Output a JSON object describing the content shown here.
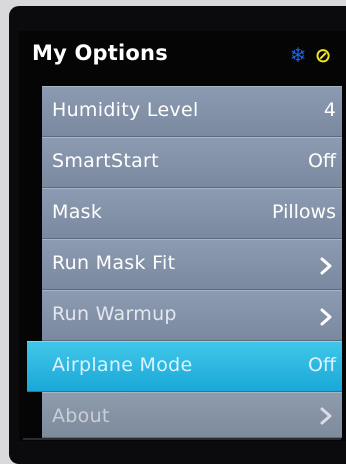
{
  "header": {
    "title": "My Options",
    "status_icons": [
      {
        "name": "snowflake-icon",
        "glyph": "❄",
        "color": "#1e63e0"
      },
      {
        "name": "no-sign-icon",
        "glyph": "⊘",
        "color": "#f2e51e"
      }
    ]
  },
  "menu": {
    "items": [
      {
        "label": "Humidity Level",
        "value": "4"
      },
      {
        "label": "SmartStart",
        "value": "Off"
      },
      {
        "label": "Mask",
        "value": "Pillows"
      },
      {
        "label": "Run Mask Fit",
        "value": "",
        "icon": "chevron-right-icon"
      },
      {
        "label": "Run Warmup",
        "value": "",
        "icon": "chevron-right-icon"
      },
      {
        "label": "Airplane Mode",
        "value": "Off",
        "selected": true
      },
      {
        "label": "About",
        "value": "",
        "icon": "chevron-right-icon"
      }
    ]
  },
  "colors": {
    "item_background": "#8596ac",
    "selected_background": "#2bb8e4",
    "screen_background": "#050506"
  }
}
